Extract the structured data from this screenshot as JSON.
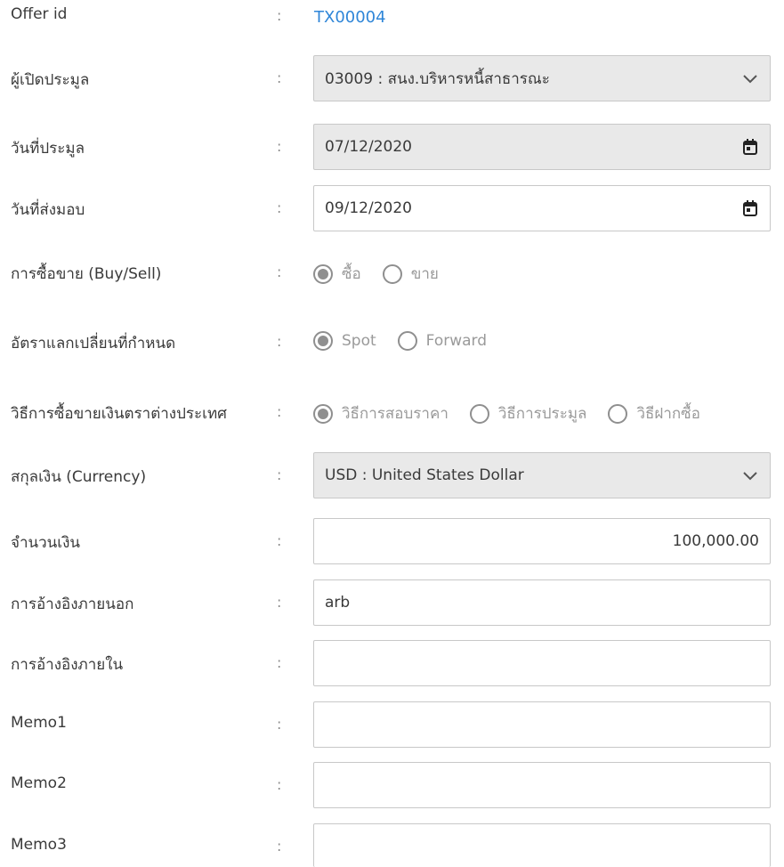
{
  "form": {
    "offer_id": {
      "label": "Offer id",
      "colon": ":",
      "value": "TX00004"
    },
    "offerer": {
      "label": "ผู้เปิดประมูล",
      "colon": ":",
      "value": "03009 : สนง.บริหารหนี้สาธารณะ",
      "icon": "chevron-down-icon"
    },
    "auction_date": {
      "label": "วันที่ประมูล",
      "colon": ":",
      "value": "07/12/2020",
      "icon": "calendar-icon"
    },
    "delivery_date": {
      "label": "วันที่ส่งมอบ",
      "colon": ":",
      "value": "09/12/2020",
      "icon": "calendar-icon"
    },
    "buy_sell": {
      "label": "การซื้อขาย (Buy/Sell)",
      "colon": ":",
      "options": [
        {
          "label": "ซื้อ",
          "checked": true
        },
        {
          "label": "ขาย",
          "checked": false
        }
      ]
    },
    "exchange_rate": {
      "label": "อัตราแลกเปลี่ยนที่กำหนด",
      "colon": ":",
      "options": [
        {
          "label": "Spot",
          "checked": true
        },
        {
          "label": "Forward",
          "checked": false
        }
      ]
    },
    "method": {
      "label": "วิธีการซื้อขายเงินตราต่างประเทศ",
      "colon": ":",
      "options": [
        {
          "label": "วิธีการสอบราคา",
          "checked": true
        },
        {
          "label": "วิธีการประมูล",
          "checked": false
        },
        {
          "label": "วิธีฝากซื้อ",
          "checked": false
        }
      ]
    },
    "currency": {
      "label": "สกุลเงิน (Currency)",
      "colon": ":",
      "value": "USD : United States Dollar",
      "icon": "chevron-down-icon"
    },
    "amount": {
      "label": "จำนวนเงิน",
      "colon": ":",
      "value": "100,000.00"
    },
    "external_ref": {
      "label": "การอ้างอิงภายนอก",
      "colon": ":",
      "value": "arb"
    },
    "internal_ref": {
      "label": "การอ้างอิงภายใน",
      "colon": ":",
      "value": ""
    },
    "memo1": {
      "label": "Memo1",
      "colon": ":",
      "value": ""
    },
    "memo2": {
      "label": "Memo2",
      "colon": ":",
      "value": ""
    },
    "memo3": {
      "label": "Memo3",
      "colon": ":",
      "value": ""
    }
  },
  "colors": {
    "link": "#2f86d8",
    "disabled_bg": "#e9e9e9",
    "border": "#c8c8c8",
    "radio": "#8f8f8f"
  }
}
